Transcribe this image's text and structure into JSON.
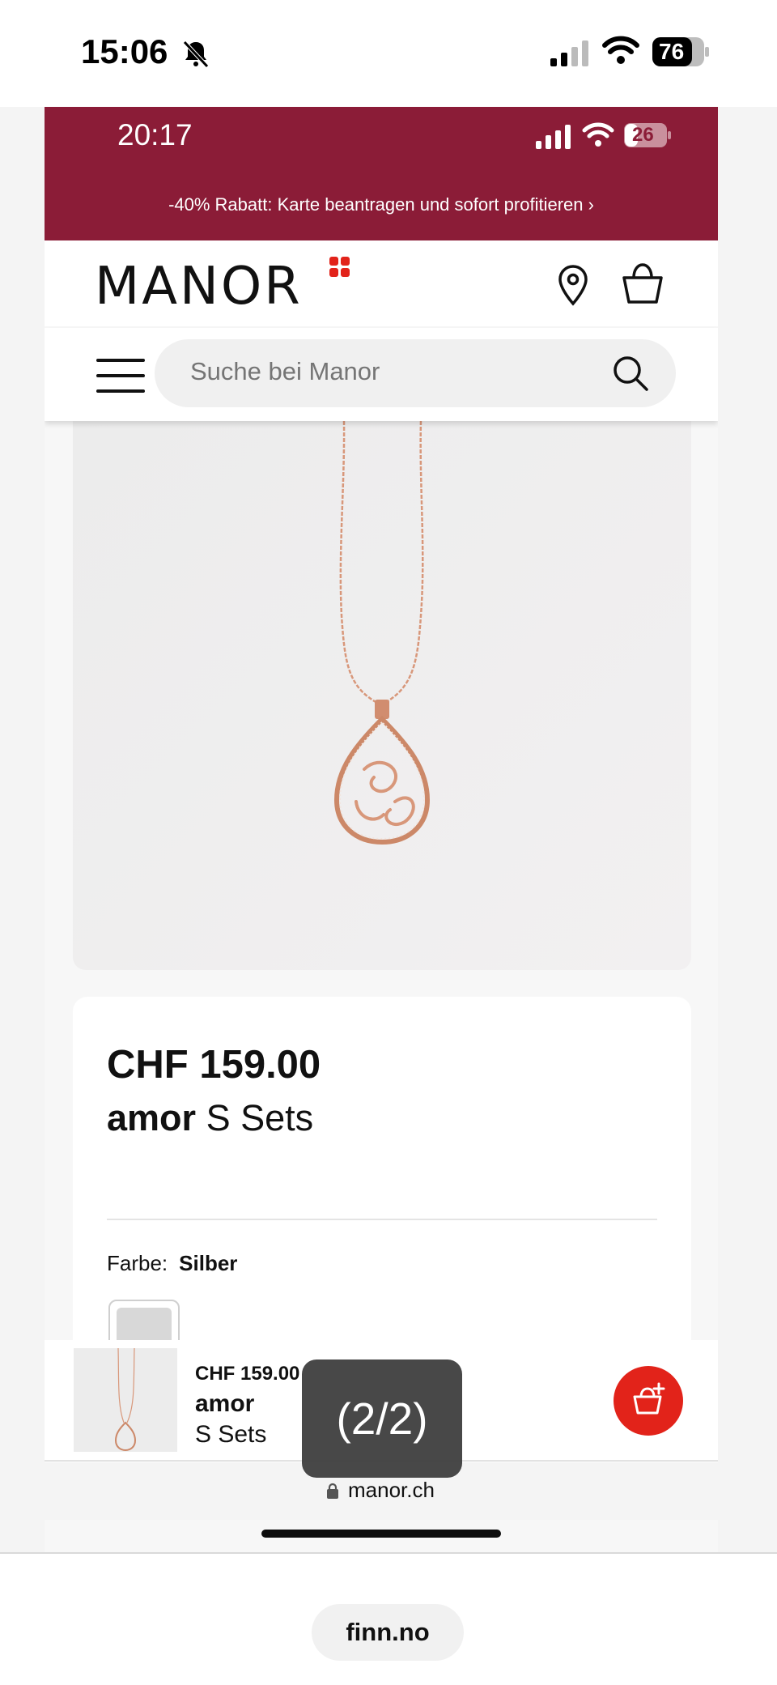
{
  "outer_status": {
    "time": "15:06",
    "battery": "76"
  },
  "inner_status": {
    "time": "20:17",
    "battery": "26"
  },
  "promo": {
    "text": "-40% Rabatt: Karte beantragen und sofort profitieren ›"
  },
  "header": {
    "logo_text": "MANOR",
    "brand_color": "#e2231a"
  },
  "search": {
    "placeholder": "Suche bei Manor"
  },
  "product": {
    "price": "CHF 159.00",
    "brand": "amor",
    "name": "S Sets",
    "color_label": "Farbe:",
    "color_value": "Silber"
  },
  "sticky_bar": {
    "price": "CHF 159.00",
    "brand": "amor",
    "name": "S Sets"
  },
  "overlay": {
    "page_counter": "(2/2)"
  },
  "browser": {
    "url": "manor.ch"
  },
  "bottom": {
    "tab_label": "finn.no"
  },
  "colors": {
    "promo_bg": "#8b1c37",
    "cart_button": "#e2231a",
    "rose_gold": "#d8977a"
  }
}
